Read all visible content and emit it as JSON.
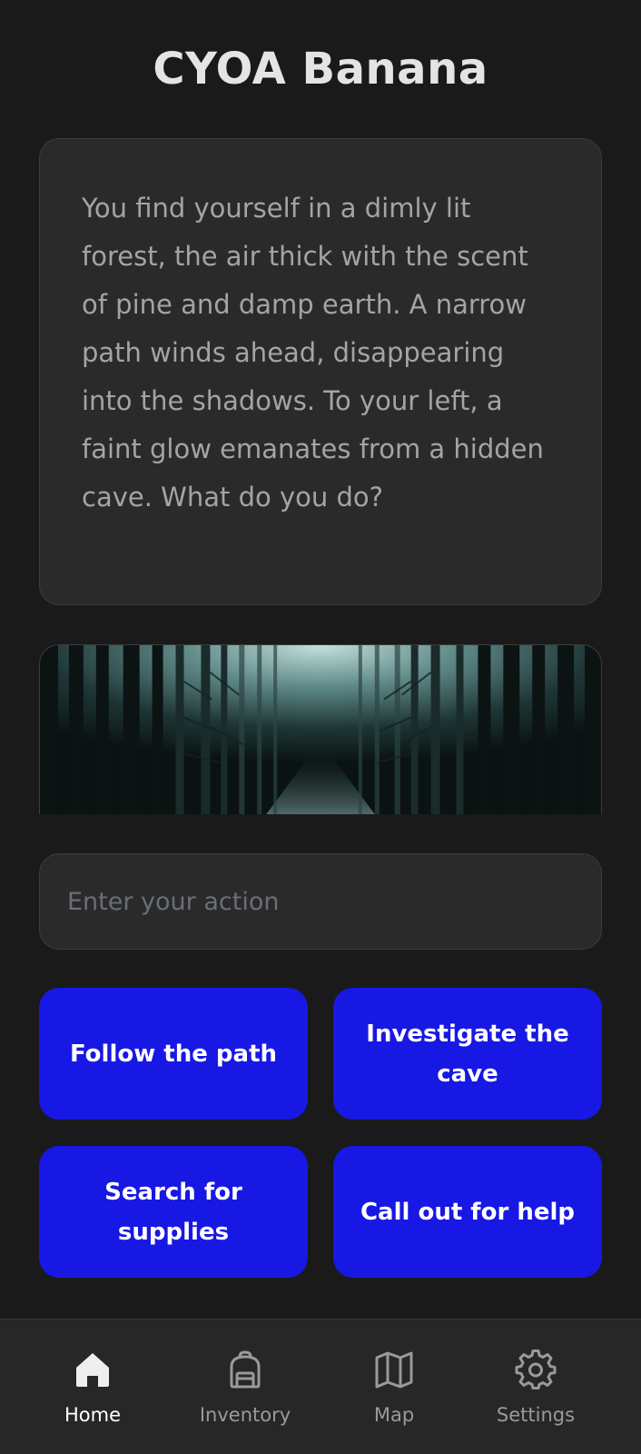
{
  "app": {
    "title": "CYOA Banana"
  },
  "story": {
    "text": "You find yourself in a dimly lit forest, the air thick with the scent of pine and damp earth. A narrow path winds ahead, disappearing into the shadows. To your left, a faint glow emanates from a hidden cave. What do you do?"
  },
  "scene_image": {
    "subject": "misty dark pine forest"
  },
  "action_input": {
    "value": "",
    "placeholder": "Enter your action"
  },
  "choices": [
    {
      "label": "Follow the path"
    },
    {
      "label": "Investigate the cave"
    },
    {
      "label": "Search for supplies"
    },
    {
      "label": "Call out for help"
    }
  ],
  "nav": {
    "active": "Home",
    "items": [
      {
        "label": "Home",
        "icon": "home-icon"
      },
      {
        "label": "Inventory",
        "icon": "backpack-icon"
      },
      {
        "label": "Map",
        "icon": "map-icon"
      },
      {
        "label": "Settings",
        "icon": "gear-icon"
      }
    ]
  },
  "colors": {
    "background": "#1a1a1a",
    "card": "#2a2a2a",
    "accent": "#1818e4",
    "text_muted": "#a4a4a4"
  }
}
